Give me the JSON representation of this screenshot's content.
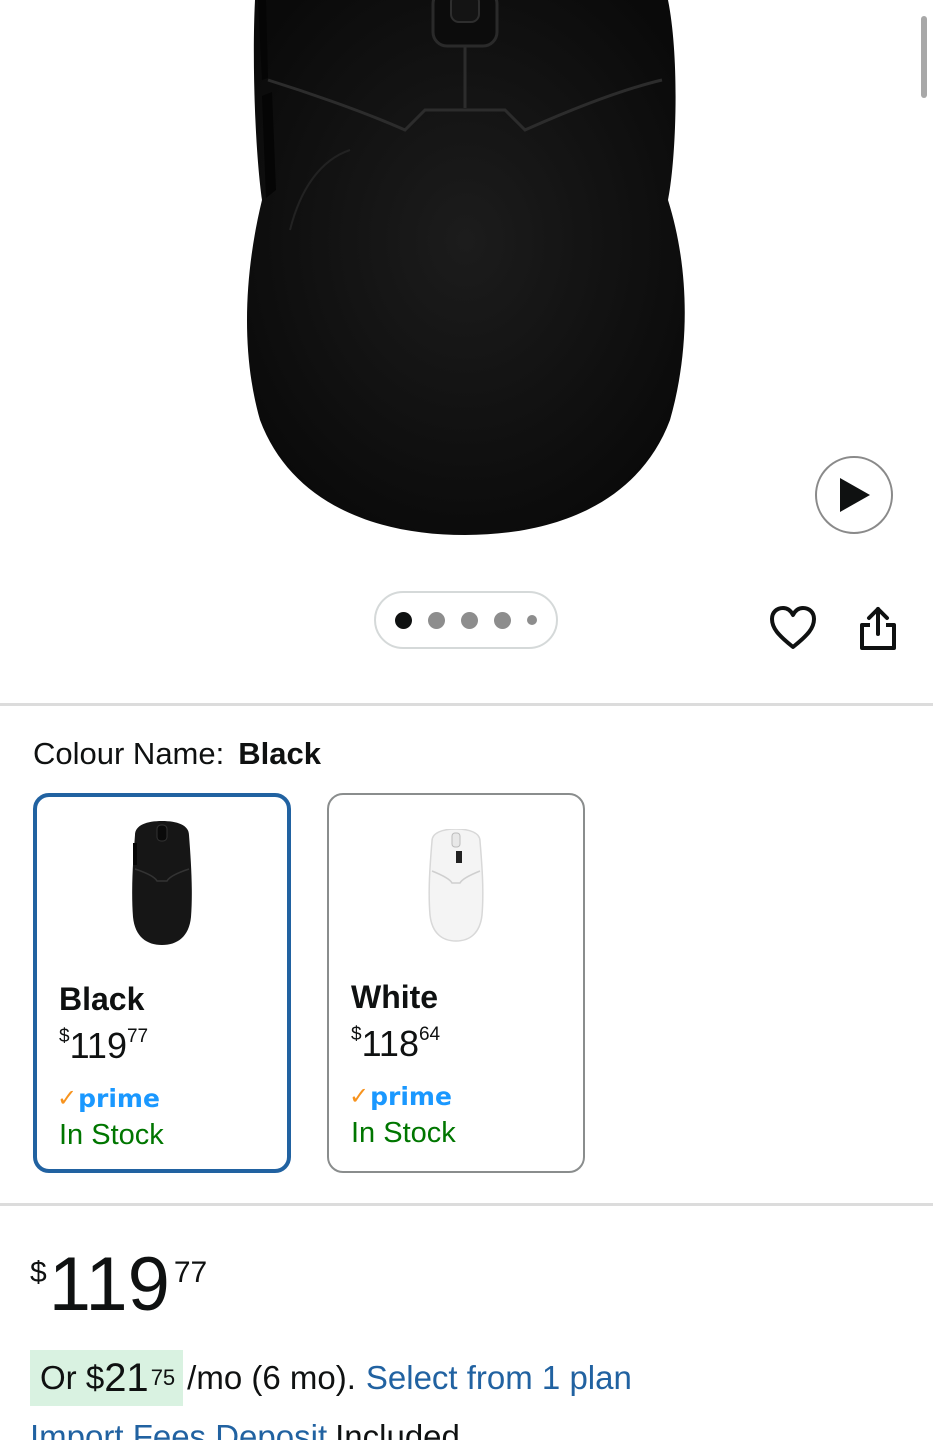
{
  "product_images": {
    "dot_count": 5,
    "active_index": 0
  },
  "colour": {
    "label": "Colour Name:",
    "selected": "Black"
  },
  "options": [
    {
      "name": "Black",
      "currency": "$",
      "whole": "119",
      "fraction": "77",
      "prime": "prime",
      "stock": "In Stock",
      "selected": true
    },
    {
      "name": "White",
      "currency": "$",
      "whole": "118",
      "fraction": "64",
      "prime": "prime",
      "stock": "In Stock",
      "selected": false
    }
  ],
  "price": {
    "currency": "$",
    "whole": "119",
    "fraction": "77"
  },
  "installment": {
    "prefix": "Or $",
    "amount_whole": "21",
    "amount_fraction": "75",
    "period": "/mo (6 mo).",
    "link": "Select from 1 plan"
  },
  "import_fees": {
    "link": "Import Fees Deposit",
    "suffix": "Included"
  },
  "colors": {
    "selected_border": "#2162a1",
    "in_stock": "#007600",
    "link": "#2162a1",
    "prime_blue": "#1a98ff",
    "prime_check": "#f7931e",
    "installment_bg": "#d9f2e1"
  },
  "icons": [
    "play-icon",
    "heart-icon",
    "share-icon",
    "prime-check-icon"
  ]
}
